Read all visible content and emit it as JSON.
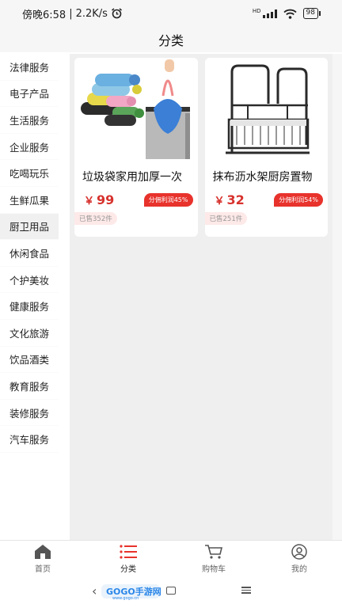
{
  "status": {
    "time": "傍晚6:58",
    "speed": "2.2K/s",
    "network": "HD",
    "battery": "98"
  },
  "header": {
    "title": "分类"
  },
  "sidebar": {
    "items": [
      {
        "label": "法律服务"
      },
      {
        "label": "电子产品"
      },
      {
        "label": "生活服务"
      },
      {
        "label": "企业服务"
      },
      {
        "label": "吃喝玩乐"
      },
      {
        "label": "生鲜瓜果"
      },
      {
        "label": "厨卫用品"
      },
      {
        "label": "休闲食品"
      },
      {
        "label": "个护美妆"
      },
      {
        "label": "健康服务"
      },
      {
        "label": "文化旅游"
      },
      {
        "label": "饮品酒类"
      },
      {
        "label": "教育服务"
      },
      {
        "label": "装修服务"
      },
      {
        "label": "汽车服务"
      }
    ],
    "active_index": 6
  },
  "products": [
    {
      "title": "垃圾袋家用加厚一次",
      "currency": "￥",
      "price": "99",
      "commission": "分佣利润45%",
      "sold": "已售352件",
      "image_icon": "garbage-bag-rolls-and-bin"
    },
    {
      "title": "抹布沥水架厨房置物",
      "currency": "￥",
      "price": "32",
      "commission": "分佣利润54%",
      "sold": "已售251件",
      "image_icon": "metal-drying-rack"
    }
  ],
  "tabbar": {
    "items": [
      {
        "label": "首页",
        "icon": "home-icon"
      },
      {
        "label": "分类",
        "icon": "list-icon"
      },
      {
        "label": "购物车",
        "icon": "cart-icon"
      },
      {
        "label": "我的",
        "icon": "user-icon"
      }
    ],
    "active_index": 1
  },
  "watermark": {
    "brand": "GOGO手游网",
    "url": "www.gogo.cn"
  },
  "colors": {
    "accent": "#e8322c",
    "price": "#d7322d",
    "background": "#efefef"
  }
}
